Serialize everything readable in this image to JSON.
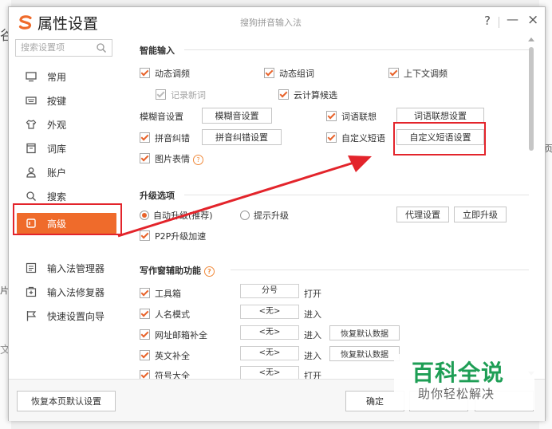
{
  "window": {
    "app_title": "属性设置",
    "center_title": "搜狗拼音输入法",
    "help_btn": "?",
    "min_btn": "—",
    "close_btn": "×"
  },
  "background": {
    "left_char": "谷",
    "right_char": "页",
    "left_char2": "片",
    "left_char3": "文"
  },
  "sidebar": {
    "search_placeholder": "搜索设置项",
    "items": [
      {
        "label": "常用",
        "icon": "monitor-icon"
      },
      {
        "label": "按键",
        "icon": "keyboard-icon"
      },
      {
        "label": "外观",
        "icon": "shirt-icon"
      },
      {
        "label": "词库",
        "icon": "book-icon"
      },
      {
        "label": "账户",
        "icon": "user-icon"
      },
      {
        "label": "搜索",
        "icon": "search-icon"
      },
      {
        "label": "高级",
        "icon": "advanced-icon",
        "active": true
      }
    ],
    "tools": [
      {
        "label": "输入法管理器",
        "icon": "manager-icon"
      },
      {
        "label": "输入法修复器",
        "icon": "repair-icon"
      },
      {
        "label": "快速设置向导",
        "icon": "wizard-flag-icon"
      }
    ]
  },
  "smart_input": {
    "title": "智能输入",
    "dynamic_freq": "动态调频",
    "dynamic_phrase": "动态组词",
    "context_freq": "上下文调频",
    "record_new": "记录新词",
    "cloud_candidates": "云计算候选",
    "fuzzy_label": "模糊音设置",
    "fuzzy_btn": "模糊音设置",
    "word_assoc": "词语联想",
    "word_assoc_btn": "词语联想设置",
    "pinyin_correct": "拼音纠错",
    "pinyin_correct_btn": "拼音纠错设置",
    "custom_phrase": "自定义短语",
    "custom_phrase_btn": "自定义短语设置",
    "picture_emoji": "图片表情"
  },
  "upgrade": {
    "title": "升级选项",
    "auto": "自动升级(推荐)",
    "prompt": "提示升级",
    "proxy_btn": "代理设置",
    "upgrade_now_btn": "立即升级",
    "p2p": "P2P升级加速"
  },
  "writing_assist": {
    "title": "写作窗辅助功能",
    "rows": [
      {
        "label": "工具箱",
        "value": "分号",
        "action": "打开",
        "restore": ""
      },
      {
        "label": "人名模式",
        "value": "<无>",
        "action": "进入",
        "restore": ""
      },
      {
        "label": "网址邮箱补全",
        "value": "<无>",
        "action": "进入",
        "restore": "恢复默认数据"
      },
      {
        "label": "英文补全",
        "value": "<无>",
        "action": "进入",
        "restore": "恢复默认数据"
      },
      {
        "label": "符号大全",
        "value": "<无>",
        "action": "打开",
        "restore": ""
      }
    ]
  },
  "bottom": {
    "restore_defaults": "恢复本页默认设置",
    "ok": "确定"
  },
  "watermark": {
    "main": "百科全说",
    "sub": "助你轻松解决"
  },
  "colors": {
    "accent": "#ef6b2b",
    "annotation_red": "#e3242b",
    "watermark_green": "#1e9e55"
  }
}
